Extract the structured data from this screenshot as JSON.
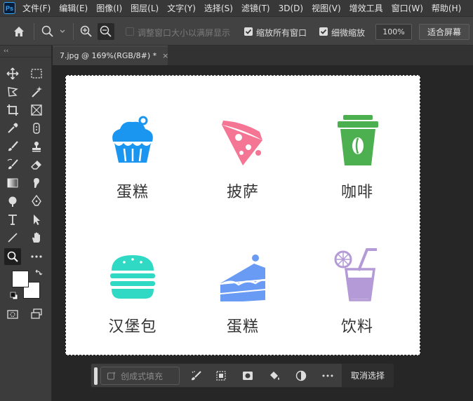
{
  "app": {
    "logo_text": "Ps"
  },
  "menu": [
    "文件(F)",
    "编辑(E)",
    "图像(I)",
    "图层(L)",
    "文字(Y)",
    "选择(S)",
    "滤镜(T)",
    "3D(D)",
    "视图(V)",
    "增效工具",
    "窗口(W)",
    "帮助(H)"
  ],
  "options": {
    "home_icon": "home-icon",
    "zoom_tool_icon": "zoom-tool-icon",
    "zoom_in_icon": "zoom-in-icon",
    "zoom_out_icon": "zoom-out-icon",
    "resize_windows_label": "调整窗口大小以满屏显示",
    "resize_windows_checked": false,
    "zoom_all_label": "缩放所有窗口",
    "zoom_all_checked": true,
    "scrubby_label": "细微缩放",
    "scrubby_checked": true,
    "zoom_value": "100%",
    "fit_screen_label": "适合屏幕"
  },
  "toolbar": {
    "collapse_label": "‹‹"
  },
  "document_tab": {
    "title": "7.jpg @ 169%(RGB/8#) *",
    "close": "×"
  },
  "canvas": {
    "items": [
      {
        "label": "蛋糕",
        "icon": "cupcake-icon",
        "color": "#1a96f0"
      },
      {
        "label": "披萨",
        "icon": "pizza-icon",
        "color": "#f47594"
      },
      {
        "label": "咖啡",
        "icon": "coffee-cup-icon",
        "color": "#4caf50"
      },
      {
        "label": "汉堡包",
        "icon": "burger-icon",
        "color": "#2fd9c4"
      },
      {
        "label": "蛋糕",
        "icon": "cake-slice-icon",
        "color": "#6a9bf4"
      },
      {
        "label": "饮料",
        "icon": "drink-icon",
        "color": "#b49ad6"
      }
    ]
  },
  "context_bar": {
    "generative_fill_label": "创成式填充",
    "deselect_label": "取消选择"
  }
}
